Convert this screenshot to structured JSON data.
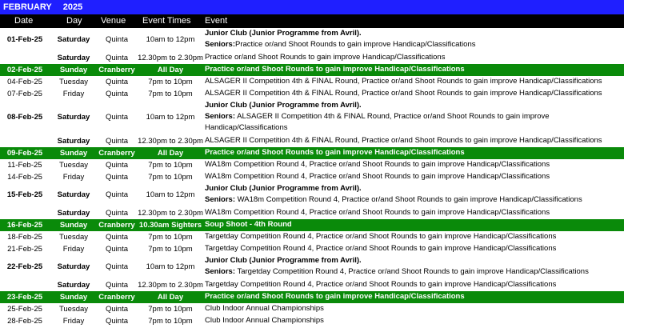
{
  "title": {
    "month": "FEBRUARY",
    "year": "2025"
  },
  "headers": {
    "date": "Date",
    "day": "Day",
    "venue": "Venue",
    "times": "Event Times",
    "event": "Event"
  },
  "colors": {
    "title_bg": "#1f1fff",
    "header_bg": "#000000",
    "highlight_bg": "#0a8a0a"
  },
  "rows": [
    {
      "date": "01-Feb-25",
      "day": "Saturday",
      "venue": "Quinta",
      "times": "10am to 12pm",
      "green": false,
      "date_bold": true,
      "day_bold": true,
      "lines": [
        {
          "b": "Junior Club (Junior Programme from Avril).",
          "t": ""
        },
        {
          "b": "Seniors:",
          "t": "Practice or/and Shoot Rounds to gain improve Handicap/Classifications"
        }
      ]
    },
    {
      "date": "",
      "day": "Saturday",
      "venue": "Quinta",
      "times": "12.30pm to 2.30pm",
      "green": false,
      "day_bold": true,
      "lines": [
        {
          "b": "",
          "t": "Practice or/and Shoot Rounds to gain improve Handicap/Classifications"
        }
      ]
    },
    {
      "date": "02-Feb-25",
      "day": "Sunday",
      "venue": "Cranberry",
      "times": "All Day",
      "green": true,
      "lines": [
        {
          "b": "",
          "t": "Practice or/and Shoot Rounds to gain improve Handicap/Classifications"
        }
      ]
    },
    {
      "date": "04-Feb-25",
      "day": "Tuesday",
      "venue": "Quinta",
      "times": "7pm to 10pm",
      "green": false,
      "lines": [
        {
          "b": "",
          "t": "ALSAGER II Competition 4th & FINAL Round, Practice or/and Shoot Rounds to gain improve Handicap/Classifications"
        }
      ]
    },
    {
      "date": "07-Feb-25",
      "day": "Friday",
      "venue": "Quinta",
      "times": "7pm to 10pm",
      "green": false,
      "lines": [
        {
          "b": "",
          "t": "ALSAGER II Competition 4th & FINAL Round, Practice or/and Shoot Rounds to gain improve Handicap/Classifications"
        }
      ]
    },
    {
      "date": "08-Feb-25",
      "day": "Saturday",
      "venue": "Quinta",
      "times": "10am to 12pm",
      "green": false,
      "date_bold": true,
      "day_bold": true,
      "lines": [
        {
          "b": "Junior Club (Junior Programme from Avril).",
          "t": ""
        },
        {
          "b": "Seniors:",
          "t": " ALSAGER II Competition 4th & FINAL Round, Practice or/and Shoot Rounds to gain improve"
        },
        {
          "b": "",
          "t": "Handicap/Classifications"
        }
      ]
    },
    {
      "date": "",
      "day": "Saturday",
      "venue": "Quinta",
      "times": "12.30pm to 2.30pm",
      "green": false,
      "day_bold": true,
      "lines": [
        {
          "b": "",
          "t": "ALSAGER II Competition 4th & FINAL Round, Practice or/and Shoot Rounds to gain improve Handicap/Classifications"
        }
      ]
    },
    {
      "date": "09-Feb-25",
      "day": "Sunday",
      "venue": "Cranberry",
      "times": "All Day",
      "green": true,
      "lines": [
        {
          "b": "",
          "t": "Practice or/and Shoot Rounds to gain improve Handicap/Classifications"
        }
      ]
    },
    {
      "date": "11-Feb-25",
      "day": "Tuesday",
      "venue": "Quinta",
      "times": "7pm to 10pm",
      "green": false,
      "lines": [
        {
          "b": "",
          "t": "WA18m Competition Round 4, Practice or/and Shoot Rounds to gain improve Handicap/Classifications"
        }
      ]
    },
    {
      "date": "14-Feb-25",
      "day": "Friday",
      "venue": "Quinta",
      "times": "7pm to 10pm",
      "green": false,
      "lines": [
        {
          "b": "",
          "t": "WA18m Competition Round 4, Practice or/and Shoot Rounds to gain improve Handicap/Classifications"
        }
      ]
    },
    {
      "date": "15-Feb-25",
      "day": "Saturday",
      "venue": "Quinta",
      "times": "10am to 12pm",
      "green": false,
      "date_bold": true,
      "day_bold": true,
      "lines": [
        {
          "b": "Junior Club (Junior Programme from Avril).",
          "t": ""
        },
        {
          "b": "Seniors:",
          "t": " WA18m Competition Round 4, Practice or/and Shoot Rounds to gain improve Handicap/Classifications"
        }
      ]
    },
    {
      "date": "",
      "day": "Saturday",
      "venue": "Quinta",
      "times": "12.30pm to 2.30pm",
      "green": false,
      "day_bold": true,
      "lines": [
        {
          "b": "",
          "t": "WA18m Competition Round 4, Practice or/and Shoot Rounds to gain improve Handicap/Classifications"
        }
      ]
    },
    {
      "date": "16-Feb-25",
      "day": "Sunday",
      "venue": "Cranberry",
      "times": "10.30am Sighters",
      "green": true,
      "lines": [
        {
          "b": "",
          "t": "Soup Shoot - 4th Round"
        }
      ]
    },
    {
      "date": "18-Feb-25",
      "day": "Tuesday",
      "venue": "Quinta",
      "times": "7pm to 10pm",
      "green": false,
      "lines": [
        {
          "b": "",
          "t": "Targetday Competition Round 4, Practice or/and Shoot Rounds to gain improve Handicap/Classifications"
        }
      ]
    },
    {
      "date": "21-Feb-25",
      "day": "Friday",
      "venue": "Quinta",
      "times": "7pm to 10pm",
      "green": false,
      "lines": [
        {
          "b": "",
          "t": "Targetday Competition Round 4, Practice or/and Shoot Rounds to gain improve Handicap/Classifications"
        }
      ]
    },
    {
      "date": "22-Feb-25",
      "day": "Saturday",
      "venue": "Quinta",
      "times": "10am to 12pm",
      "green": false,
      "date_bold": true,
      "day_bold": true,
      "lines": [
        {
          "b": "Junior Club (Junior Programme from Avril).",
          "t": ""
        },
        {
          "b": "Seniors:",
          "t": " Targetday Competition Round 4, Practice or/and Shoot Rounds to gain improve Handicap/Classifications"
        }
      ]
    },
    {
      "date": "",
      "day": "Saturday",
      "venue": "Quinta",
      "times": "12.30pm to 2.30pm",
      "green": false,
      "day_bold": true,
      "lines": [
        {
          "b": "",
          "t": "Targetday Competition Round 4, Practice or/and Shoot Rounds to gain improve Handicap/Classifications"
        }
      ]
    },
    {
      "date": "23-Feb-25",
      "day": "Sunday",
      "venue": "Cranberry",
      "times": "All Day",
      "green": true,
      "lines": [
        {
          "b": "",
          "t": "Practice or/and Shoot Rounds to gain improve Handicap/Classifications"
        }
      ]
    },
    {
      "date": "25-Feb-25",
      "day": "Tuesday",
      "venue": "Quinta",
      "times": "7pm to 10pm",
      "green": false,
      "lines": [
        {
          "b": "",
          "t": "Club Indoor Annual Championships"
        }
      ]
    },
    {
      "date": "28-Feb-25",
      "day": "Friday",
      "venue": "Quinta",
      "times": "7pm to 10pm",
      "green": false,
      "lines": [
        {
          "b": "",
          "t": "Club Indoor Annual Championships"
        }
      ]
    }
  ]
}
